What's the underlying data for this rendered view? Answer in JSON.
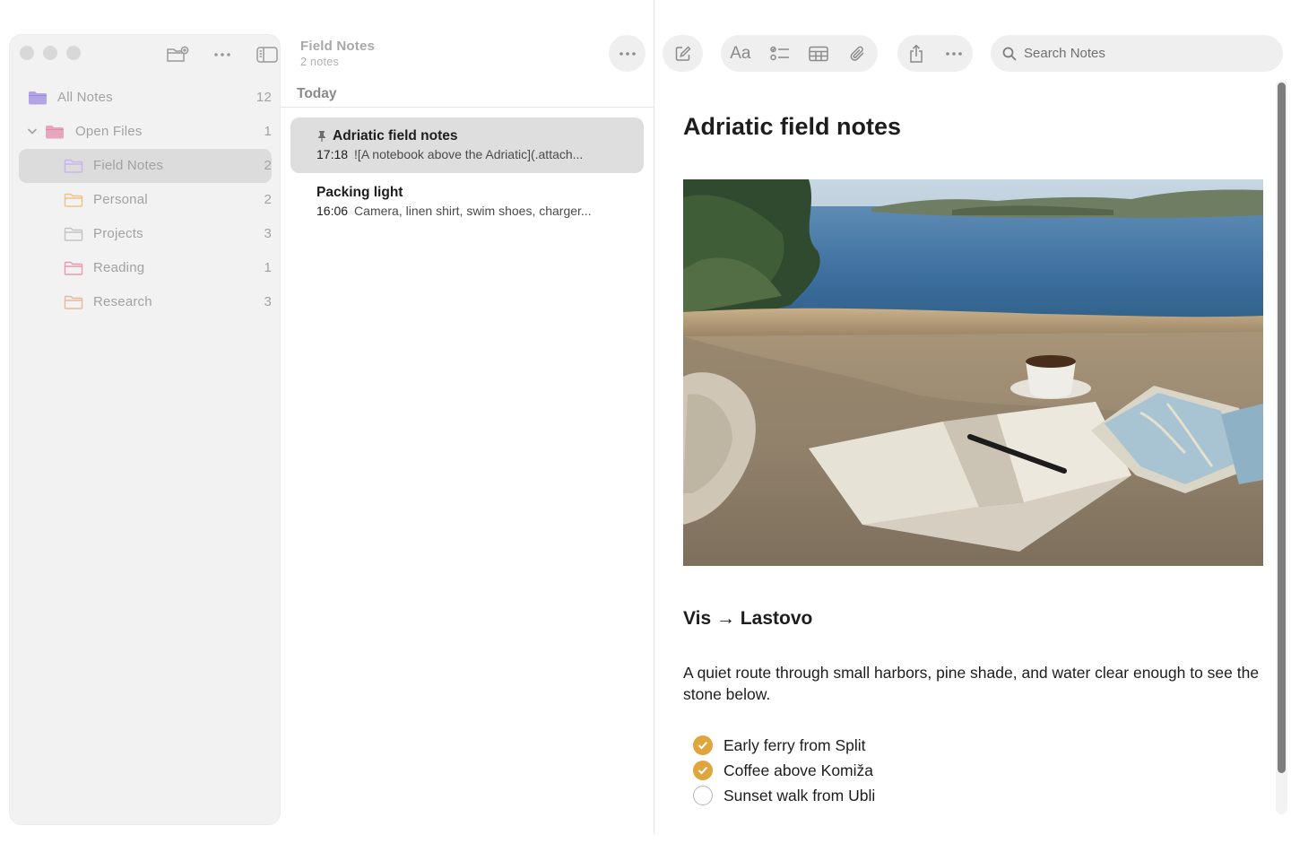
{
  "sidebar": {
    "items": [
      {
        "label": "All Notes",
        "count": "12",
        "color": "#b3a4e3"
      },
      {
        "label": "Open Files",
        "count": "1",
        "color": "#e7a6bd"
      },
      {
        "label": "Field Notes",
        "count": "2",
        "color": "#c9b4ee"
      },
      {
        "label": "Personal",
        "count": "2",
        "color": "#edc38a"
      },
      {
        "label": "Projects",
        "count": "3",
        "color": "#c4c4c4"
      },
      {
        "label": "Reading",
        "count": "1",
        "color": "#e99aaa"
      },
      {
        "label": "Research",
        "count": "3",
        "color": "#edb49c"
      }
    ]
  },
  "notelist": {
    "title": "Field Notes",
    "subtitle": "2 notes",
    "section": "Today",
    "notes": [
      {
        "title": "Adriatic field notes",
        "time": "17:18",
        "preview": "![A notebook above the Adriatic](.attach...",
        "pinned": true
      },
      {
        "title": "Packing light",
        "time": "16:06",
        "preview": "Camera, linen shirt, swim shoes, charger..."
      }
    ]
  },
  "toolbar": {
    "format_label": "Aa",
    "search_placeholder": "Search Notes"
  },
  "editor": {
    "title": "Adriatic field notes",
    "heading": "Vis → Lastovo",
    "paragraph": "A quiet route through small harbors, pine shade, and water clear enough to see the stone below.",
    "checklist": [
      {
        "label": "Early ferry from Split",
        "done": true
      },
      {
        "label": "Coffee above Komiža",
        "done": true
      },
      {
        "label": "Sunset walk from Ubli",
        "done": false
      }
    ]
  },
  "colors": {
    "accent": "#e1a53d"
  }
}
